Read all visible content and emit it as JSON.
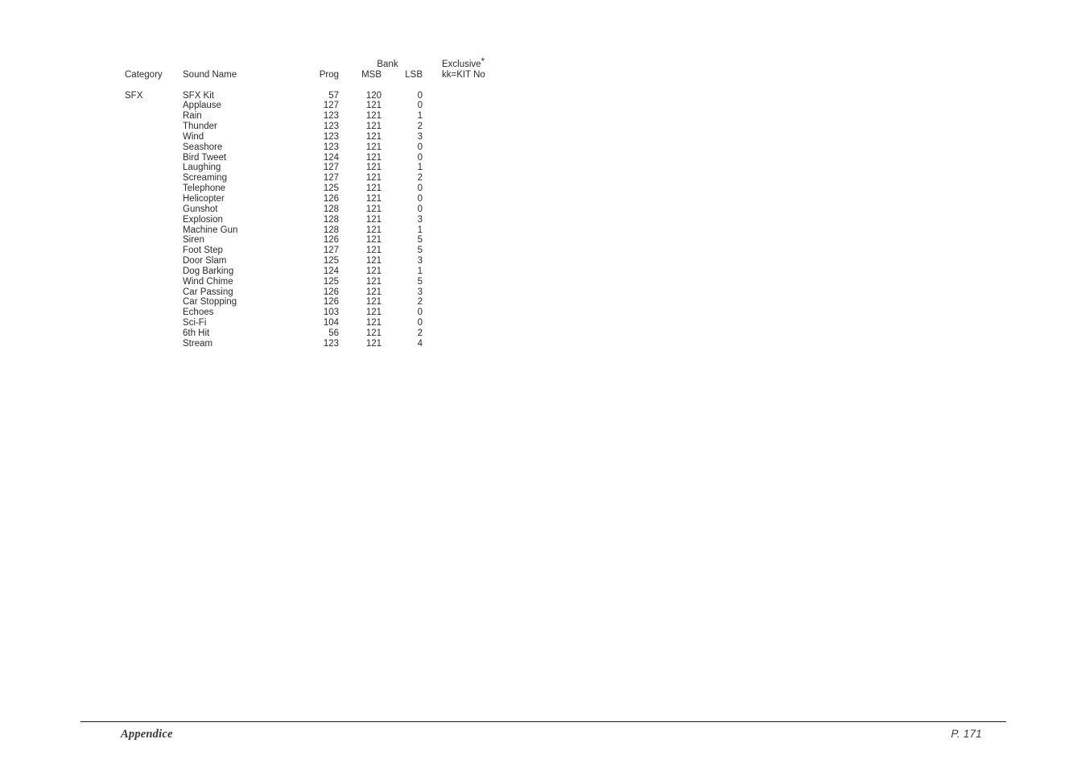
{
  "table": {
    "headers": {
      "category": "Category",
      "sound_name": "Sound Name",
      "prog": "Prog",
      "bank_group": "Bank",
      "msb": "MSB",
      "lsb": "LSB",
      "exclusive_line1": "Exclusive",
      "exclusive_marker": "*",
      "exclusive_line2": "kk=KIT No"
    },
    "rows": [
      {
        "category": "SFX",
        "sound_name": "SFX Kit",
        "prog": "57",
        "msb": "120",
        "lsb": "0",
        "exclusive": ""
      },
      {
        "category": "",
        "sound_name": "Applause",
        "prog": "127",
        "msb": "121",
        "lsb": "0",
        "exclusive": ""
      },
      {
        "category": "",
        "sound_name": "Rain",
        "prog": "123",
        "msb": "121",
        "lsb": "1",
        "exclusive": ""
      },
      {
        "category": "",
        "sound_name": "Thunder",
        "prog": "123",
        "msb": "121",
        "lsb": "2",
        "exclusive": ""
      },
      {
        "category": "",
        "sound_name": "Wind",
        "prog": "123",
        "msb": "121",
        "lsb": "3",
        "exclusive": ""
      },
      {
        "category": "",
        "sound_name": "Seashore",
        "prog": "123",
        "msb": "121",
        "lsb": "0",
        "exclusive": ""
      },
      {
        "category": "",
        "sound_name": "Bird Tweet",
        "prog": "124",
        "msb": "121",
        "lsb": "0",
        "exclusive": ""
      },
      {
        "category": "",
        "sound_name": "Laughing",
        "prog": "127",
        "msb": "121",
        "lsb": "1",
        "exclusive": ""
      },
      {
        "category": "",
        "sound_name": "Screaming",
        "prog": "127",
        "msb": "121",
        "lsb": "2",
        "exclusive": ""
      },
      {
        "category": "",
        "sound_name": "Telephone",
        "prog": "125",
        "msb": "121",
        "lsb": "0",
        "exclusive": ""
      },
      {
        "category": "",
        "sound_name": "Helicopter",
        "prog": "126",
        "msb": "121",
        "lsb": "0",
        "exclusive": ""
      },
      {
        "category": "",
        "sound_name": "Gunshot",
        "prog": "128",
        "msb": "121",
        "lsb": "0",
        "exclusive": ""
      },
      {
        "category": "",
        "sound_name": "Explosion",
        "prog": "128",
        "msb": "121",
        "lsb": "3",
        "exclusive": ""
      },
      {
        "category": "",
        "sound_name": "Machine Gun",
        "prog": "128",
        "msb": "121",
        "lsb": "1",
        "exclusive": ""
      },
      {
        "category": "",
        "sound_name": "Siren",
        "prog": "126",
        "msb": "121",
        "lsb": "5",
        "exclusive": ""
      },
      {
        "category": "",
        "sound_name": "Foot Step",
        "prog": "127",
        "msb": "121",
        "lsb": "5",
        "exclusive": ""
      },
      {
        "category": "",
        "sound_name": "Door Slam",
        "prog": "125",
        "msb": "121",
        "lsb": "3",
        "exclusive": ""
      },
      {
        "category": "",
        "sound_name": "Dog Barking",
        "prog": "124",
        "msb": "121",
        "lsb": "1",
        "exclusive": ""
      },
      {
        "category": "",
        "sound_name": "Wind Chime",
        "prog": "125",
        "msb": "121",
        "lsb": "5",
        "exclusive": ""
      },
      {
        "category": "",
        "sound_name": "Car Passing",
        "prog": "126",
        "msb": "121",
        "lsb": "3",
        "exclusive": ""
      },
      {
        "category": "",
        "sound_name": "Car Stopping",
        "prog": "126",
        "msb": "121",
        "lsb": "2",
        "exclusive": ""
      },
      {
        "category": "",
        "sound_name": "Echoes",
        "prog": "103",
        "msb": "121",
        "lsb": "0",
        "exclusive": ""
      },
      {
        "category": "",
        "sound_name": "Sci-Fi",
        "prog": "104",
        "msb": "121",
        "lsb": "0",
        "exclusive": ""
      },
      {
        "category": "",
        "sound_name": "6th Hit",
        "prog": "56",
        "msb": "121",
        "lsb": "2",
        "exclusive": ""
      },
      {
        "category": "",
        "sound_name": "Stream",
        "prog": "123",
        "msb": "121",
        "lsb": "4",
        "exclusive": ""
      }
    ]
  },
  "footer": {
    "section_label": "Appendice",
    "page_label": "P. 171"
  }
}
